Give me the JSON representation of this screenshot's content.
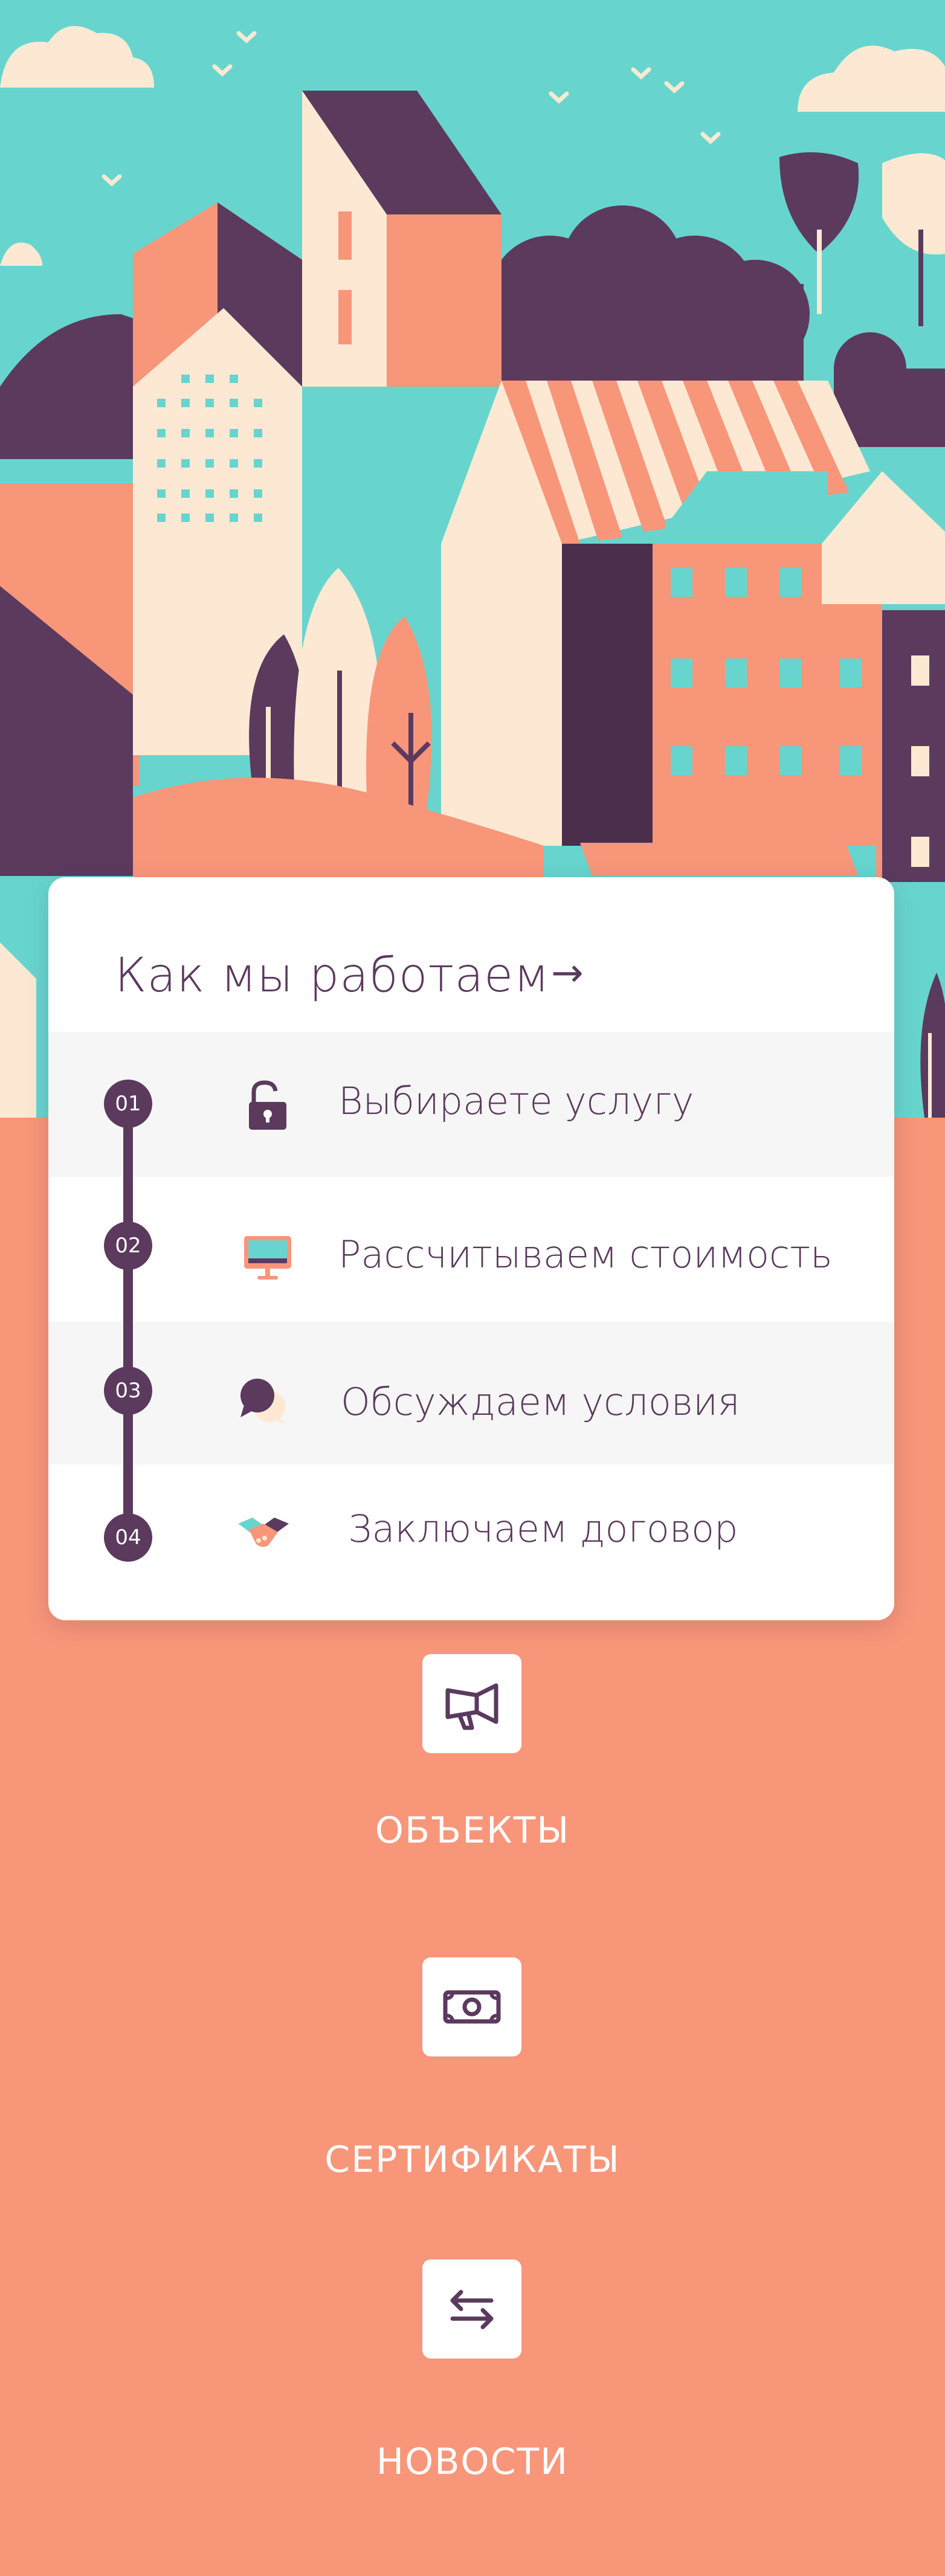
{
  "how_we_work": {
    "title": "Как мы работаем",
    "steps": [
      {
        "number": "01",
        "label": "Выбираете услугу",
        "icon": "lock-open-icon"
      },
      {
        "number": "02",
        "label": "Рассчитываем стоимость",
        "icon": "monitor-icon"
      },
      {
        "number": "03",
        "label": "Обсуждаем условия",
        "icon": "chat-bubbles-icon"
      },
      {
        "number": "04",
        "label": "Заключаем договор",
        "icon": "handshake-icon"
      }
    ]
  },
  "nav": {
    "items": [
      {
        "label": "ОБЪЕКТЫ",
        "icon": "megaphone-icon"
      },
      {
        "label": "СЕРТИФИКАТЫ",
        "icon": "banknote-icon"
      },
      {
        "label": "НОВОСТИ",
        "icon": "swap-arrows-icon"
      }
    ]
  },
  "colors": {
    "background": "#F8967A",
    "accent_dark": "#5B3A5E",
    "teal": "#67D5CE",
    "cream": "#FDE9D3",
    "coral": "#F8967A"
  }
}
